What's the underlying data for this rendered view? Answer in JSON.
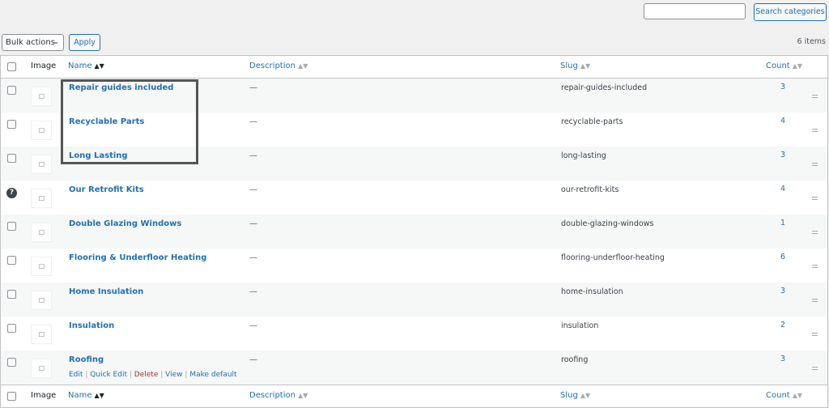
{
  "search": {
    "placeholder": "",
    "button": "Search categories"
  },
  "bulk": {
    "label": "Bulk actions",
    "apply": "Apply"
  },
  "items_count": "6 items",
  "columns": {
    "image": "Image",
    "name": "Name",
    "description": "Description",
    "slug": "Slug",
    "count": "Count"
  },
  "rows": [
    {
      "name": "Repair guides included",
      "description": "—",
      "slug": "repair-guides-included",
      "count": "3"
    },
    {
      "name": "Recyclable Parts",
      "description": "—",
      "slug": "recyclable-parts",
      "count": "4"
    },
    {
      "name": "Long Lasting",
      "description": "—",
      "slug": "long-lasting",
      "count": "3"
    },
    {
      "name": "Our Retrofit Kits",
      "description": "—",
      "slug": "our-retrofit-kits",
      "count": "4"
    },
    {
      "name": "Double Glazing Windows",
      "description": "—",
      "slug": "double-glazing-windows",
      "count": "1"
    },
    {
      "name": "Flooring & Underfloor Heating",
      "description": "—",
      "slug": "flooring-underfloor-heating",
      "count": "6"
    },
    {
      "name": "Home Insulation",
      "description": "—",
      "slug": "home-insulation",
      "count": "3"
    },
    {
      "name": "Insulation",
      "description": "—",
      "slug": "insulation",
      "count": "2"
    },
    {
      "name": "Roofing",
      "description": "—",
      "slug": "roofing",
      "count": "3"
    }
  ],
  "row_actions": {
    "edit": "Edit",
    "quick_edit": "Quick Edit",
    "delete": "Delete",
    "view": "View",
    "make_default": "Make default",
    "sep": "|"
  },
  "help_icon": "?"
}
